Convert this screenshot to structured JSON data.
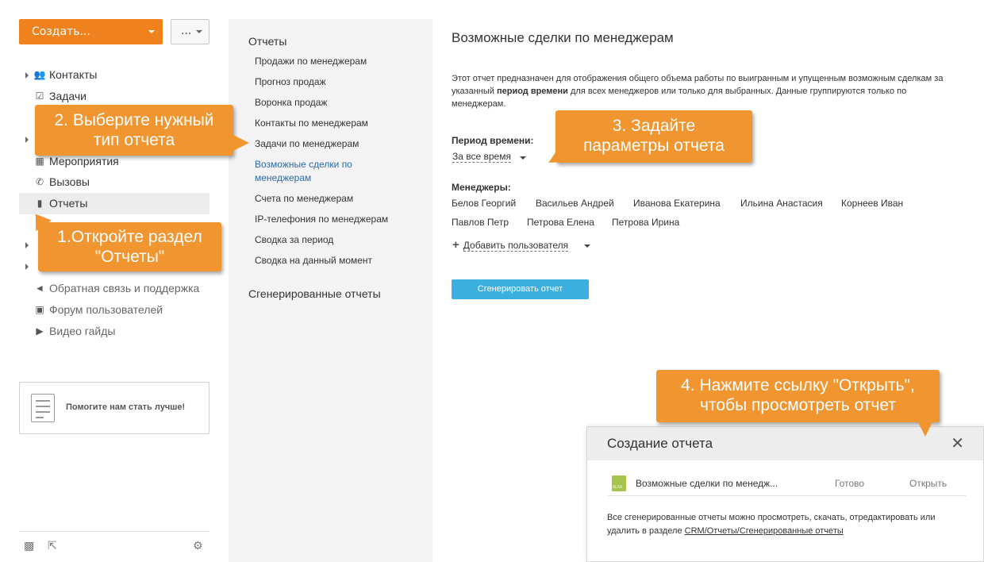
{
  "toolbar": {
    "create_label": "Создать...",
    "more_label": "..."
  },
  "sidebar": {
    "items": [
      {
        "label": "Контакты",
        "icon": "contacts-icon"
      },
      {
        "label": "Задачи",
        "icon": "tasks-icon"
      },
      {
        "label": "Мероприятия",
        "icon": "events-icon"
      },
      {
        "label": "Вызовы",
        "icon": "calls-icon"
      },
      {
        "label": "Отчеты",
        "icon": "reports-icon"
      },
      {
        "label": "Обратная связь и поддержка",
        "icon": "megaphone-icon"
      },
      {
        "label": "Форум пользователей",
        "icon": "forum-icon"
      },
      {
        "label": "Видео гайды",
        "icon": "video-icon"
      }
    ],
    "feedback": "Помогите нам стать лучше!"
  },
  "reports_menu": {
    "header": "Отчеты",
    "items": [
      "Продажи по менеджерам",
      "Прогноз продаж",
      "Воронка продаж",
      "Контакты по менеджерам",
      "Задачи по менеджерам",
      "Возможные сделки по менеджерам",
      "Счета по менеджерам",
      "IP-телефония по менеджерам",
      "Сводка за период",
      "Сводка на данный момент"
    ],
    "generated_header": "Сгенерированные отчеты"
  },
  "main": {
    "title": "Возможные сделки по менеджерам",
    "desc_part1": "Этот отчет предназначен для отображения общего объема работы по выигранным и упущенным возможным сделкам за указанный ",
    "desc_bold": "период времени",
    "desc_part2": " для всех менеджеров или только для выбранных. Данные группируются только по менеджерам.",
    "period_label": "Период времени:",
    "period_value": "За все время",
    "managers_label": "Менеджеры:",
    "managers": [
      "Белов Георгий",
      "Васильев Андрей",
      "Иванова Екатерина",
      "Ильина Анастасия",
      "Корнеев Иван",
      "Павлов Петр",
      "Петрова Елена",
      "Петрова Ирина"
    ],
    "add_user": "Добавить пользователя",
    "generate_button": "Сгенерировать отчет"
  },
  "popup": {
    "title": "Создание отчета",
    "file_name": "Возможные сделки по менедж...",
    "file_type": "XLSX",
    "status": "Готово",
    "open_link": "Открыть",
    "note_text": "Все сгенерированные отчеты можно просмотреть, скачать, отредактировать или удалить в разделе ",
    "note_link": "CRM/Отчеты/Сгенерированные отчеты"
  },
  "callouts": {
    "step1_line1": "1.Откройте раздел",
    "step1_line2": "\"Отчеты\"",
    "step2_line1": "2. Выберите нужный",
    "step2_line2": "тип отчета",
    "step3_line1": "3. Задайте",
    "step3_line2": "параметры отчета",
    "step4_line1": "4. Нажмите ссылку \"Открыть\",",
    "step4_line2": "чтобы просмотреть отчет"
  },
  "colors": {
    "accent": "#f0821e",
    "callout": "#f0952f",
    "primary_button": "#3bb0e0",
    "link": "#2b6aa8"
  }
}
